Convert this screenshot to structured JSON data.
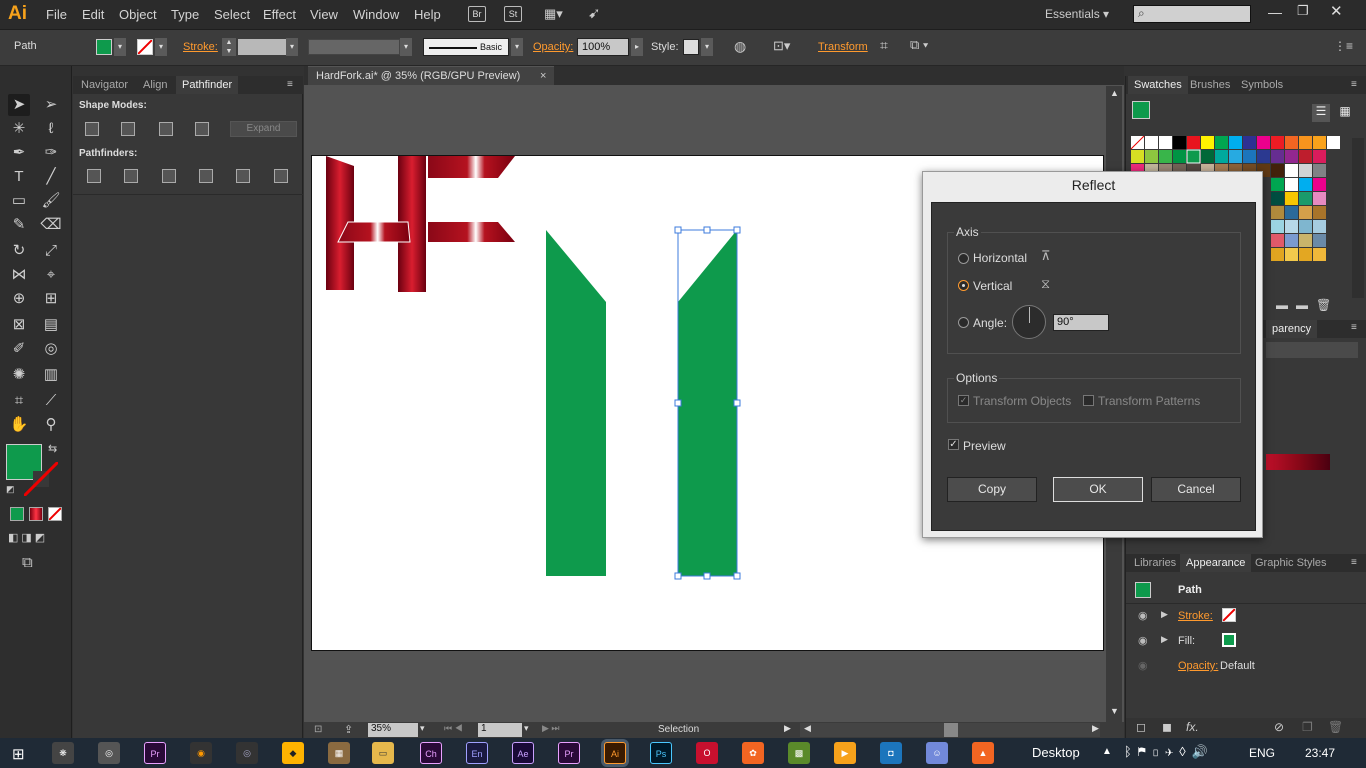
{
  "app": {
    "logo": "Ai",
    "workspace": "Essentials"
  },
  "menu": [
    "File",
    "Edit",
    "Object",
    "Type",
    "Select",
    "Effect",
    "View",
    "Window",
    "Help"
  ],
  "bridge": [
    "Br",
    "St"
  ],
  "control": {
    "selection_type": "Path",
    "stroke_label": "Stroke:",
    "opacity_label": "Opacity:",
    "opacity_value": "100%",
    "style_label": "Style:",
    "brush_label": "Basic",
    "transform_label": "Transform",
    "fill_color": "#0e9a4c"
  },
  "left_panel": {
    "tabs": [
      "Navigator",
      "Align",
      "Pathfinder"
    ],
    "shape_modes": "Shape Modes:",
    "expand": "Expand",
    "pathfinders": "Pathfinders:"
  },
  "document": {
    "tab_title": "HardFork.ai* @ 35% (RGB/GPU Preview)",
    "zoom": "35%",
    "page": "1",
    "status": "Selection"
  },
  "dialog": {
    "title": "Reflect",
    "axis_label": "Axis",
    "horizontal": "Horizontal",
    "vertical": "Vertical",
    "angle_label": "Angle:",
    "angle_value": "90°",
    "options_label": "Options",
    "transform_objects": "Transform Objects",
    "transform_patterns": "Transform Patterns",
    "preview": "Preview",
    "copy": "Copy",
    "ok": "OK",
    "cancel": "Cancel",
    "selected_axis": "vertical"
  },
  "right_panel": {
    "swatch_tabs": [
      "Swatches",
      "Brushes",
      "Symbols"
    ],
    "transparency_tab": "parency",
    "appearance_tabs": [
      "Libraries",
      "Appearance",
      "Graphic Styles"
    ],
    "appearance_title": "Path",
    "stroke_label": "Stroke:",
    "fill_label": "Fill:",
    "opacity_label": "Opacity:",
    "opacity_value": "Default"
  },
  "taskbar": {
    "desktop": "Desktop",
    "lang": "ENG",
    "time": "23:47",
    "apps": [
      "Pr",
      "Ch",
      "En",
      "Ae",
      "Pr",
      "Ai",
      "Ps"
    ]
  },
  "colors": {
    "accent": "#ff9a2e",
    "green": "#0e9a4c",
    "dark_red": "#9a0a1f"
  }
}
